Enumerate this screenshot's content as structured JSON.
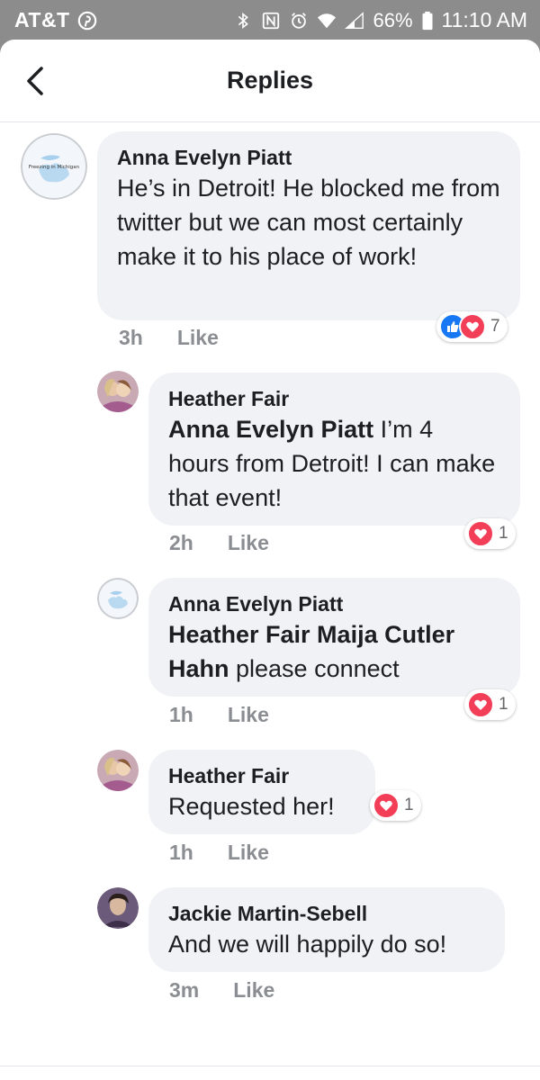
{
  "status_bar": {
    "carrier": "AT&T",
    "battery": "66%",
    "time": "11:10 AM"
  },
  "header": {
    "title": "Replies"
  },
  "comments": [
    {
      "author": "Anna Evelyn Piatt",
      "text": "He’s in Detroit! He blocked me from twitter but we can most certainly make it to his place of work!",
      "time": "3h",
      "like_label": "Like",
      "reaction_count": "7",
      "avatar_caption": "Freezing in Michigan"
    },
    {
      "author": "Heather Fair",
      "mention": "Anna Evelyn Piatt",
      "text": " I’m 4 hours from Detroit! I can make that event!",
      "time": "2h",
      "like_label": "Like",
      "reaction_count": "1"
    },
    {
      "author": "Anna Evelyn Piatt",
      "mention": "Heather Fair Maija Cutler Hahn",
      "text": " please connect",
      "time": "1h",
      "like_label": "Like",
      "reaction_count": "1",
      "avatar_caption": "Freezing in Michigan"
    },
    {
      "author": "Heather Fair",
      "text": "Requested her!",
      "time": "1h",
      "like_label": "Like",
      "reaction_count": "1"
    },
    {
      "author": "Jackie Martin-Sebell",
      "text": "And we will happily do so!",
      "time": "3m",
      "like_label": "Like"
    }
  ],
  "colors": {
    "like_blue": "#1877f2",
    "love_red": "#f33e58",
    "bubble_bg": "#f0f2f5",
    "meta_gray": "#8a8d91"
  }
}
